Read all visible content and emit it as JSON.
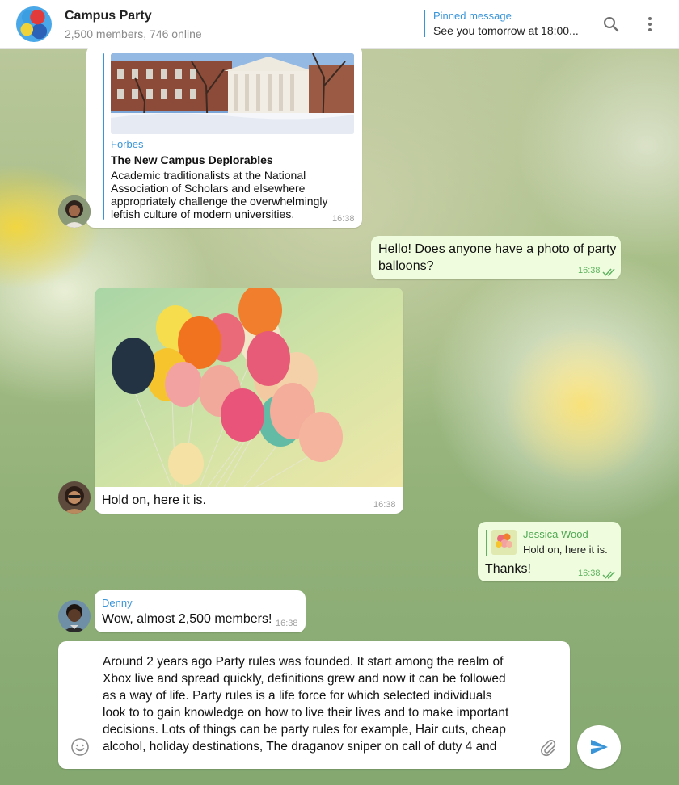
{
  "header": {
    "title": "Campus Party",
    "subtitle": "2,500 members, 746 online",
    "pinned_label": "Pinned message",
    "pinned_text": "See you tomorrow at 18:00...",
    "icons": [
      "search-icon",
      "more-vertical-icon"
    ]
  },
  "messages": [
    {
      "type": "link-preview",
      "direction": "incoming",
      "site": "Forbes",
      "title": "The New Campus Deplorables",
      "description_lines": [
        "Academic traditionalists at the National",
        "Association of Scholars and elsewhere",
        "appropriately challenge the overwhelmingly",
        "leftish culture of modern universities."
      ],
      "time": "16:38"
    },
    {
      "type": "text",
      "direction": "outgoing",
      "lines": [
        "Hello! Does anyone have a photo of party",
        "balloons?"
      ],
      "time": "16:38",
      "status": "read"
    },
    {
      "type": "photo",
      "direction": "incoming",
      "caption": "Hold on, here it is.",
      "time": "16:38"
    },
    {
      "type": "reply",
      "direction": "outgoing",
      "reply_to_name": "Jessica Wood",
      "reply_to_text": "Hold on, here it is.",
      "text": "Thanks!",
      "time": "16:38",
      "status": "read"
    },
    {
      "type": "text",
      "direction": "incoming",
      "sender": "Denny",
      "text": "Wow, almost 2,500 members!",
      "time": "16:38"
    }
  ],
  "composer": {
    "lines": [
      "Around 2 years ago Party rules was founded. It start among the realm of",
      "Xbox live and spread quickly, definitions grew and now it can be followed",
      "as a way of life. Party rules is a life force for which selected individuals",
      "look to to gain knowledge on how to live their lives and to make important",
      "decisions. Lots of things can be party rules for example, Hair cuts, cheap",
      "alcohol, holiday destinations, The draganov sniper on call of duty 4 and"
    ],
    "icons": [
      "emoji-icon",
      "attach-icon",
      "send-icon"
    ]
  },
  "colors": {
    "accent": "#3a95d8",
    "outgoing_bubble": "#effdde",
    "read_check": "#5fb360"
  }
}
